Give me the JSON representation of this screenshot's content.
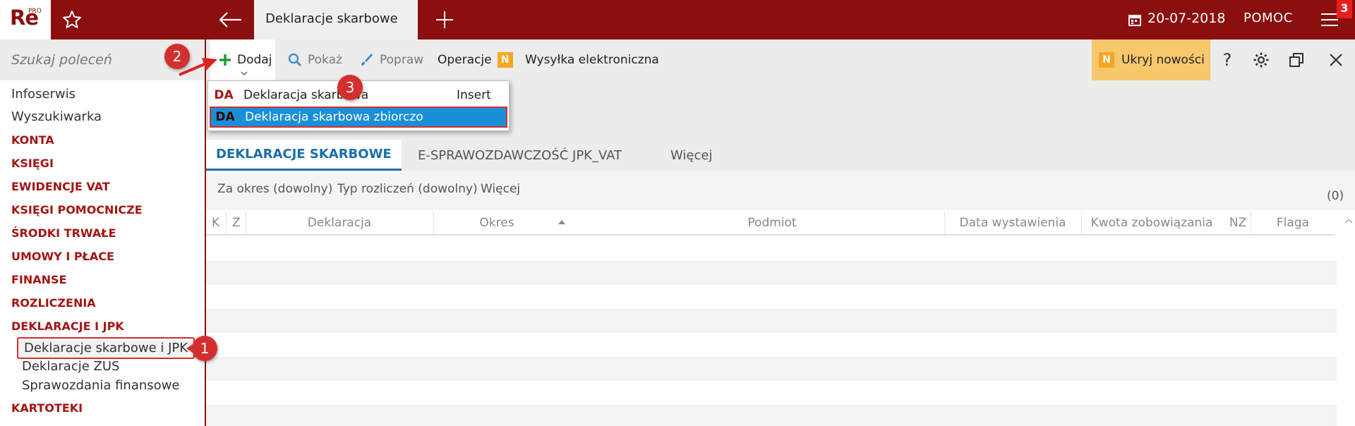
{
  "topbar": {
    "logo": "Re",
    "logo_super": "PRO",
    "active_tab": "Deklaracje skarbowe",
    "date": "20-07-2018",
    "help": "POMOC",
    "notification_count": "3",
    "icons": [
      "star-icon",
      "back-arrow-icon",
      "plus-icon",
      "calendar-icon",
      "hamburger-icon"
    ]
  },
  "sidebar": {
    "search_placeholder": "Szukaj poleceń",
    "items": [
      {
        "label": "Infoserwis",
        "kind": "link"
      },
      {
        "label": "Wyszukiwarka",
        "kind": "link"
      },
      {
        "label": "KONTA",
        "kind": "category"
      },
      {
        "label": "KSIĘGI",
        "kind": "category"
      },
      {
        "label": "EWIDENCJE VAT",
        "kind": "category"
      },
      {
        "label": "KSIĘGI POMOCNICZE",
        "kind": "category"
      },
      {
        "label": "ŚRODKI TRWAŁE",
        "kind": "category"
      },
      {
        "label": "UMOWY I PŁACE",
        "kind": "category"
      },
      {
        "label": "FINANSE",
        "kind": "category"
      },
      {
        "label": "ROZLICZENIA",
        "kind": "category"
      },
      {
        "label": "DEKLARACJE I JPK",
        "kind": "category"
      },
      {
        "label": "Deklaracje skarbowe i JPK",
        "kind": "selected"
      },
      {
        "label": "Deklaracje ZUS",
        "kind": "sub"
      },
      {
        "label": "Sprawozdania finansowe",
        "kind": "sub"
      },
      {
        "label": "KARTOTEKI",
        "kind": "category"
      }
    ]
  },
  "toolbar": {
    "add": "Dodaj",
    "show": "Pokaż",
    "edit": "Popraw",
    "operations": "Operacje",
    "n_badge": "N",
    "send": "Wysyłka elektroniczna",
    "hide_news": "Ukryj nowości",
    "help_icon": "?"
  },
  "dropdown": {
    "items": [
      {
        "code": "DA",
        "label": "Deklaracja skarbowa",
        "shortcut": "Insert"
      },
      {
        "code": "DA",
        "label": "Deklaracja skarbowa zbiorczo",
        "shortcut": ""
      }
    ]
  },
  "tabs": {
    "items": [
      "DEKLARACJE SKARBOWE",
      "E-SPRAWOZDAWCZOŚĆ JPK_VAT",
      "Więcej"
    ]
  },
  "filters": {
    "period": "Za okres (dowolny)",
    "type": "Typ rozliczeń (dowolny)",
    "more": "Więcej",
    "count": "(0)"
  },
  "grid": {
    "columns": [
      "K",
      "Z",
      "Deklaracja",
      "Okres",
      "Podmiot",
      "Data wystawienia",
      "Kwota zobowiązania",
      "NZ",
      "Flaga"
    ],
    "rows": []
  },
  "callouts": [
    "1",
    "2",
    "3"
  ],
  "colors": {
    "brand": "#8b0f0f",
    "accent": "#1a8fd6",
    "callout": "#d32f2f",
    "news": "#f5a623"
  }
}
